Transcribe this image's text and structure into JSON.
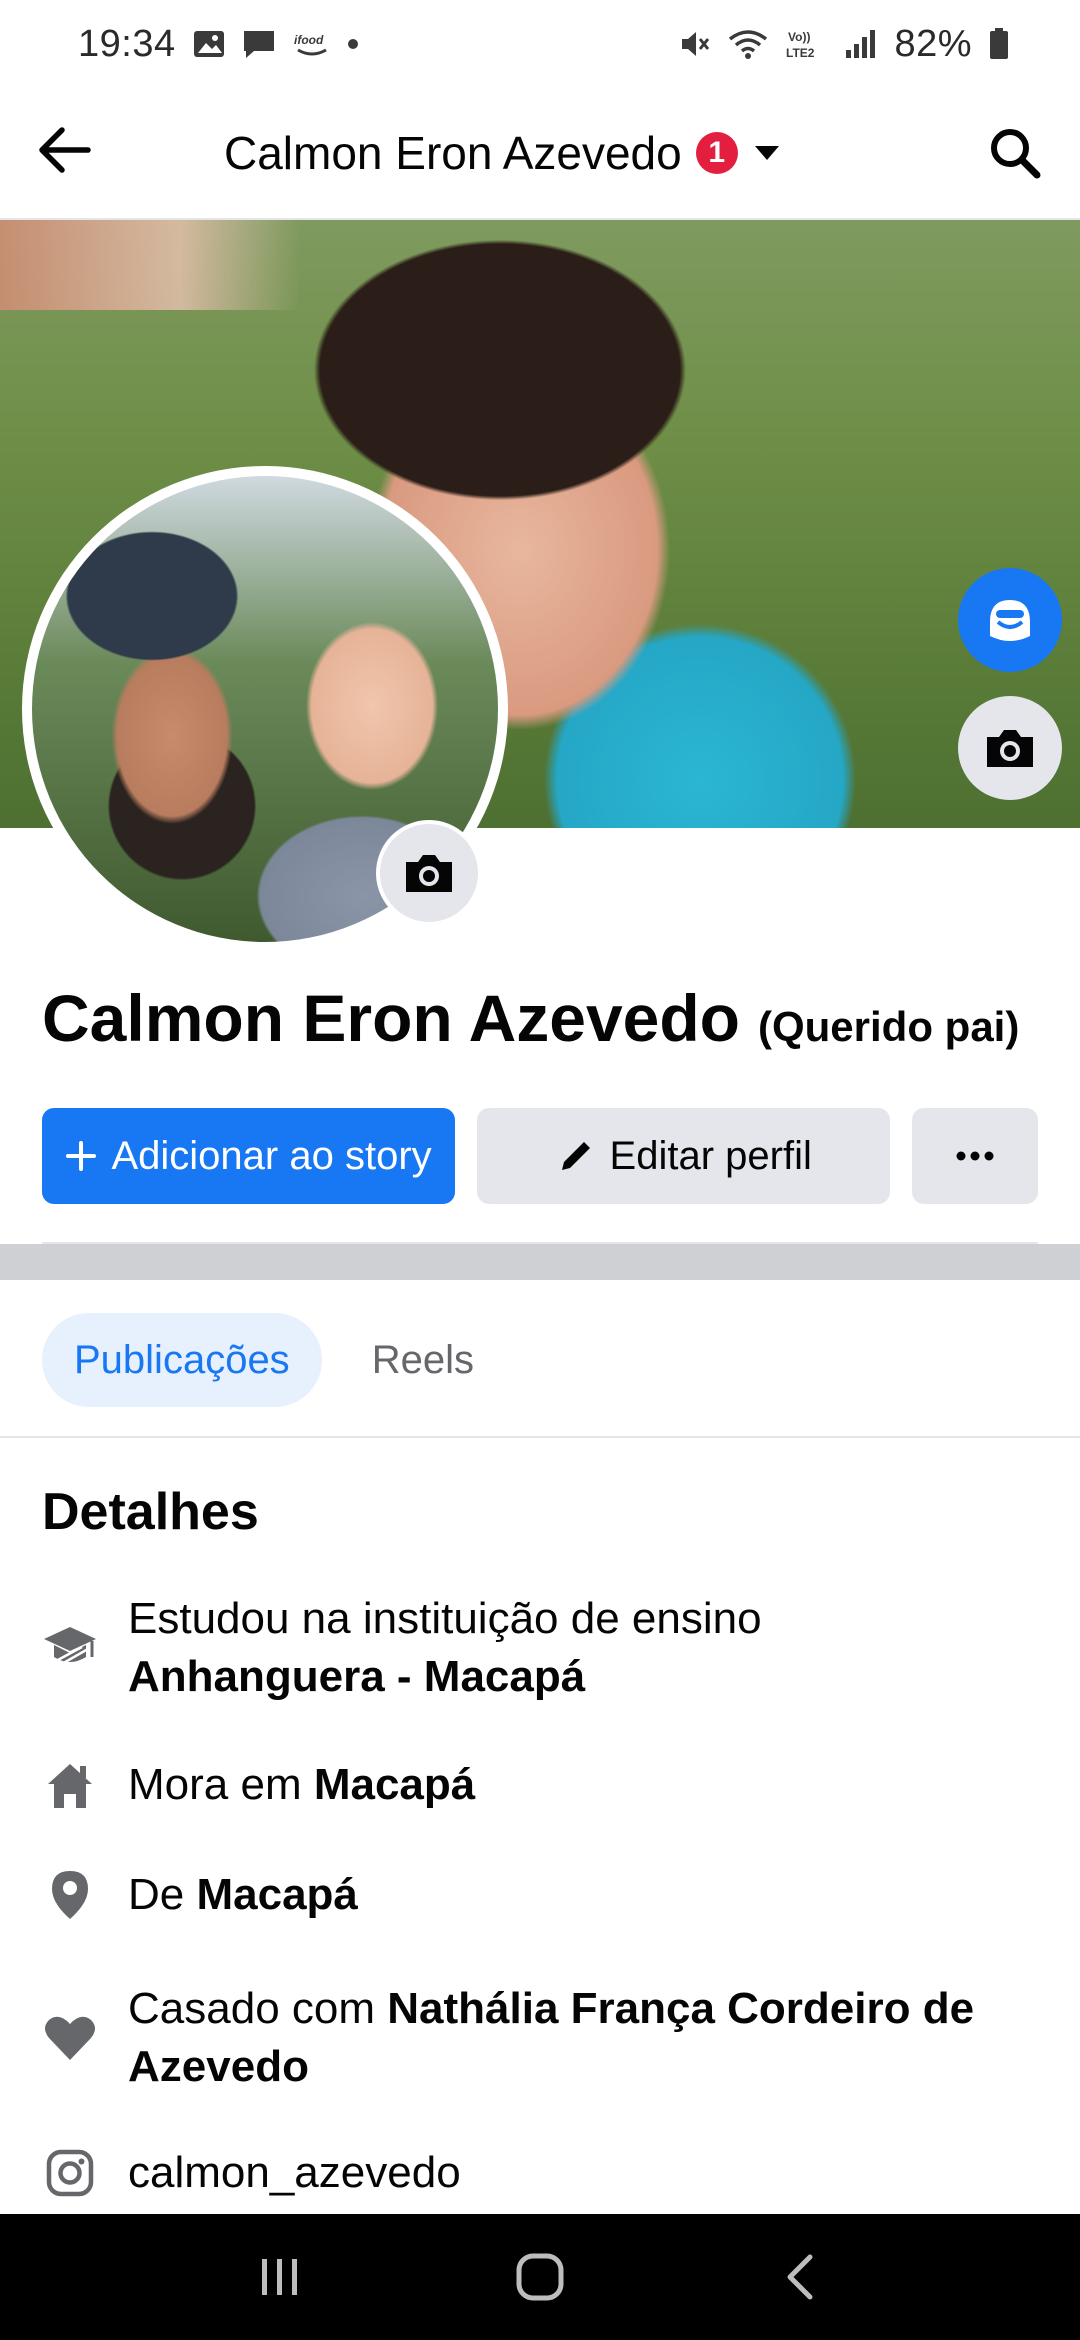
{
  "status_bar": {
    "time": "19:34",
    "battery": "82%",
    "icons": [
      "gallery-icon",
      "message-icon",
      "ifood-icon",
      "dot-icon",
      "mute-icon",
      "wifi-icon",
      "volte-icon",
      "signal-icon",
      "battery-icon"
    ],
    "network_label": "Vo)) LTE2"
  },
  "header": {
    "title": "Calmon Eron Azevedo",
    "notification_count": "1"
  },
  "profile": {
    "name": "Calmon Eron Azevedo",
    "alternate_name": "(Querido pai)"
  },
  "actions": {
    "add_story": "Adicionar ao story",
    "edit_profile": "Editar perfil",
    "more": "···"
  },
  "tabs": [
    {
      "label": "Publicações",
      "active": true
    },
    {
      "label": "Reels",
      "active": false
    }
  ],
  "details": {
    "title": "Detalhes",
    "items": [
      {
        "icon": "graduation-cap-icon",
        "prefix": "Estudou na instituição de ensino",
        "value": "Anhanguera - Macapá"
      },
      {
        "icon": "home-icon",
        "prefix": "Mora em",
        "value": "Macapá"
      },
      {
        "icon": "location-pin-icon",
        "prefix": "De",
        "value": "Macapá"
      },
      {
        "icon": "heart-icon",
        "prefix": "Casado com",
        "value": "Nathália França Cordeiro de Azevedo"
      },
      {
        "icon": "instagram-icon",
        "prefix": "",
        "value": "calmon_azevedo"
      }
    ]
  },
  "colors": {
    "accent": "#1877f2",
    "badge": "#e41e3f",
    "secondary_button": "#e4e6eb",
    "icon_gray": "#65676b"
  }
}
